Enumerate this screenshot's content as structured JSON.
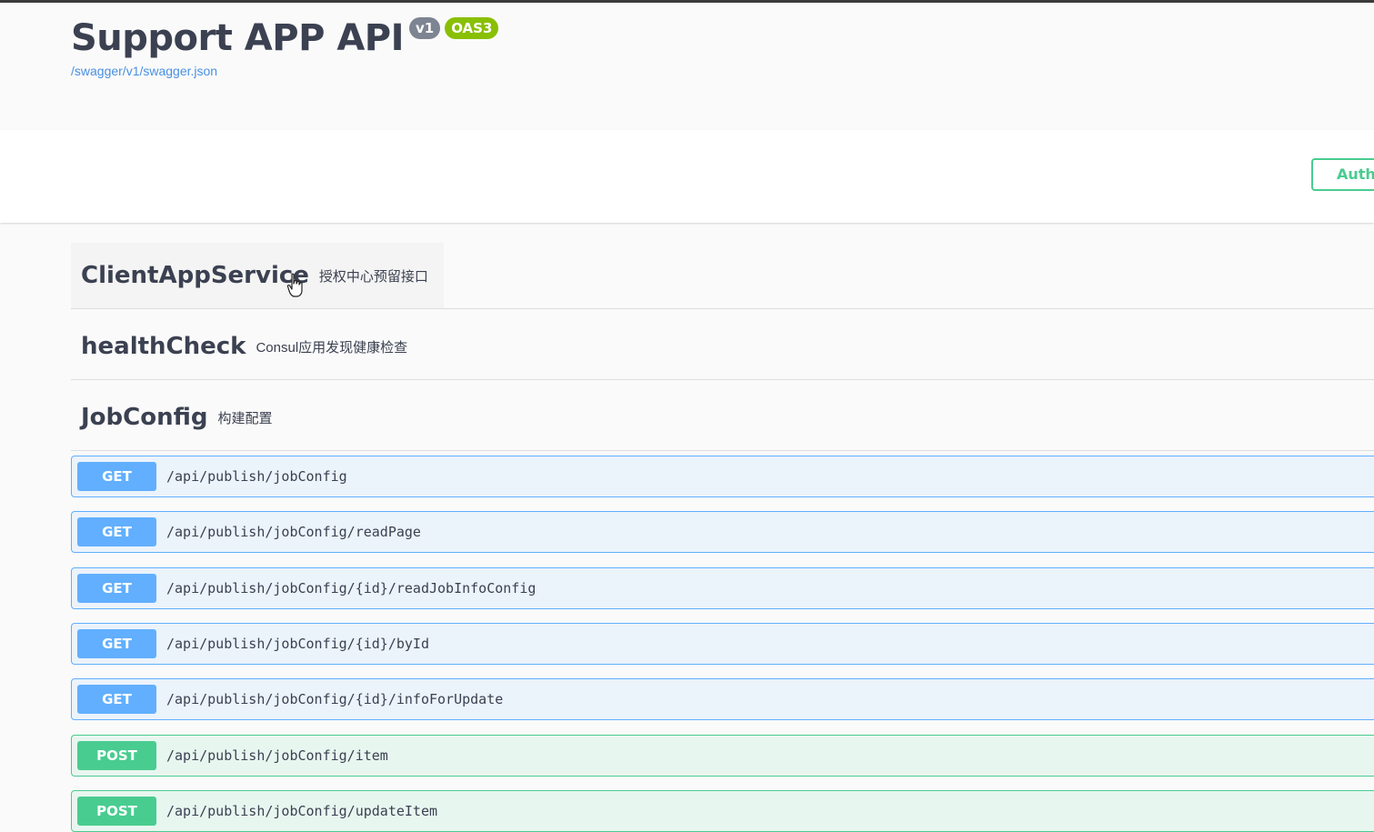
{
  "info": {
    "title": "Support APP API",
    "version_badge": "v1",
    "oas_badge": "OAS3",
    "spec_link": "/swagger/v1/swagger.json"
  },
  "scheme": {
    "authorize_label": "Authorize"
  },
  "tags": [
    {
      "name": "ClientAppService",
      "description": "授权中心预留接口"
    },
    {
      "name": "healthCheck",
      "description": "Consul应用发现健康检查"
    },
    {
      "name": "JobConfig",
      "description": "构建配置"
    }
  ],
  "operations": [
    {
      "method": "GET",
      "path": "/api/publish/jobConfig"
    },
    {
      "method": "GET",
      "path": "/api/publish/jobConfig/readPage"
    },
    {
      "method": "GET",
      "path": "/api/publish/jobConfig/{id}/readJobInfoConfig"
    },
    {
      "method": "GET",
      "path": "/api/publish/jobConfig/{id}/byId"
    },
    {
      "method": "GET",
      "path": "/api/publish/jobConfig/{id}/infoForUpdate"
    },
    {
      "method": "POST",
      "path": "/api/publish/jobConfig/item"
    },
    {
      "method": "POST",
      "path": "/api/publish/jobConfig/updateItem"
    }
  ],
  "colors": {
    "get": "#61affe",
    "post": "#49cc90",
    "link": "#4990e2",
    "oas_badge": "#89bf04"
  }
}
